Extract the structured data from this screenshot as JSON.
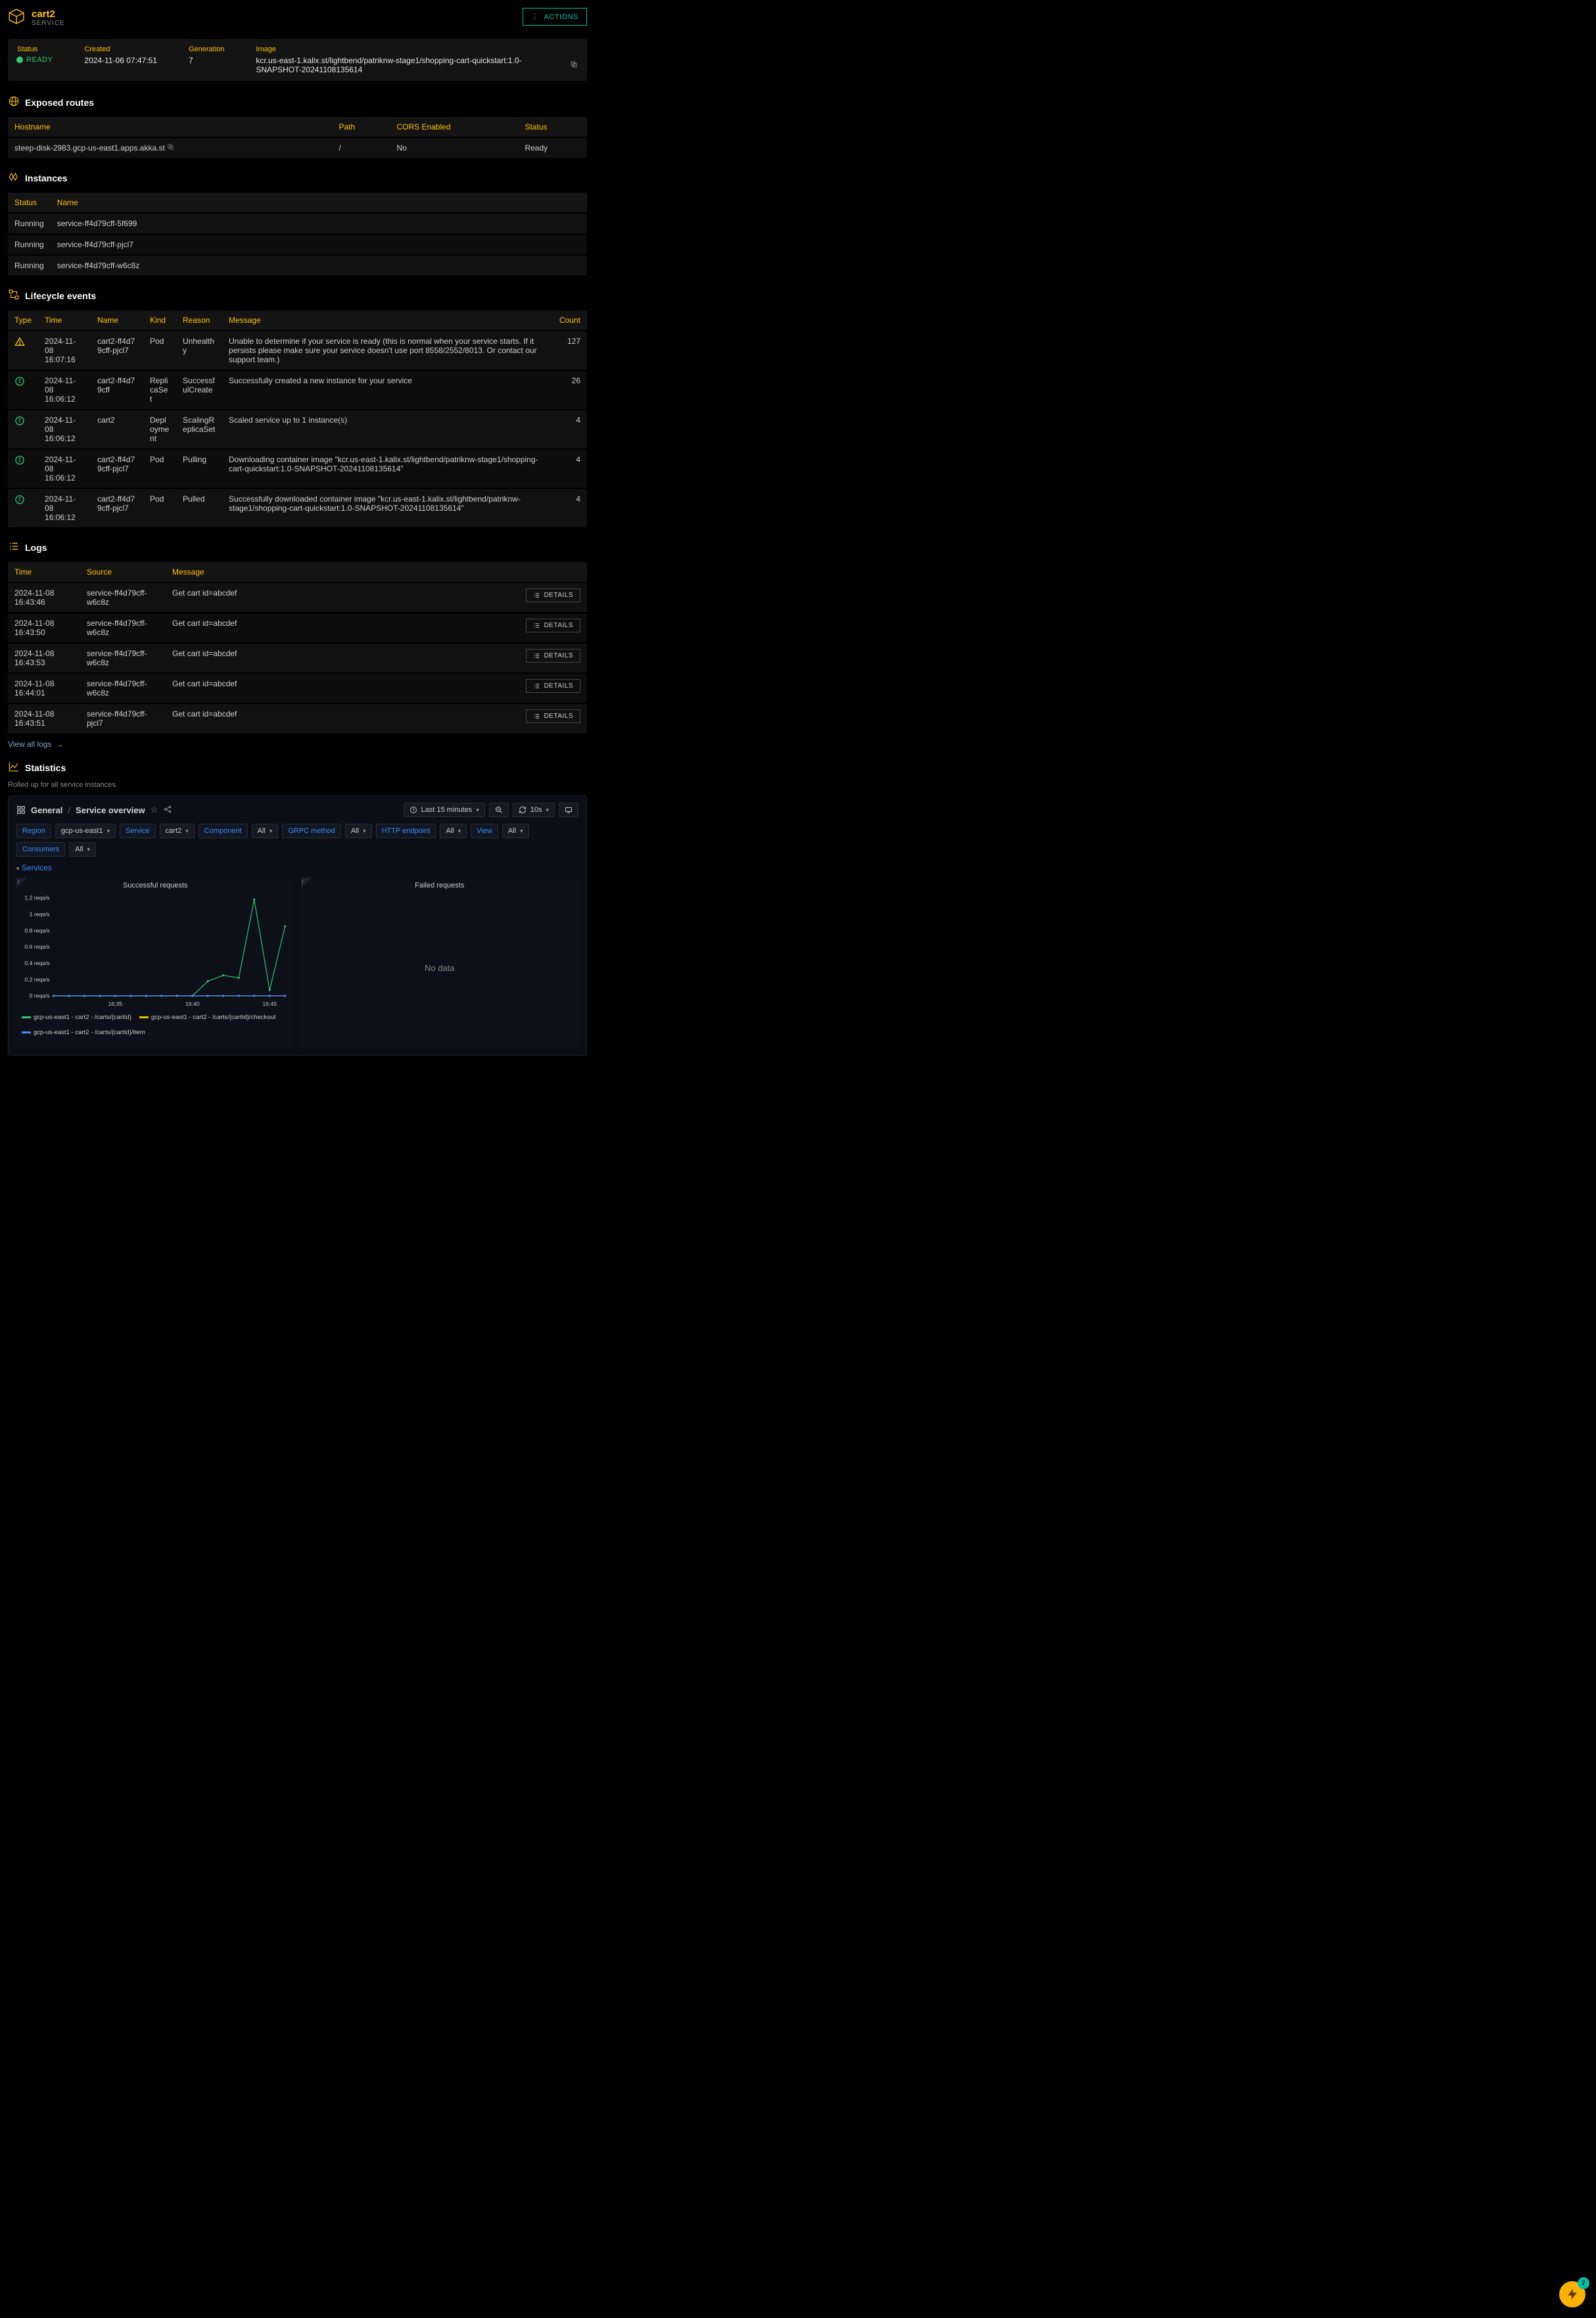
{
  "header": {
    "title": "cart2",
    "subtitle": "SERVICE",
    "actions_label": "ACTIONS"
  },
  "status_bar": {
    "status_label": "Status",
    "status_value": "READY",
    "created_label": "Created",
    "created_value": "2024-11-06 07:47:51",
    "generation_label": "Generation",
    "generation_value": "7",
    "image_label": "Image",
    "image_value": "kcr.us-east-1.kalix.st/lightbend/patriknw-stage1/shopping-cart-quickstart:1.0-SNAPSHOT-20241108135614"
  },
  "routes": {
    "heading": "Exposed routes",
    "cols": {
      "host": "Hostname",
      "path": "Path",
      "cors": "CORS Enabled",
      "status": "Status"
    },
    "rows": [
      {
        "host": "steep-disk-2983.gcp-us-east1.apps.akka.st",
        "path": "/",
        "cors": "No",
        "status": "Ready"
      }
    ]
  },
  "instances": {
    "heading": "Instances",
    "cols": {
      "status": "Status",
      "name": "Name"
    },
    "rows": [
      {
        "status": "Running",
        "name": "service-ff4d79cff-5f699"
      },
      {
        "status": "Running",
        "name": "service-ff4d79cff-pjcl7"
      },
      {
        "status": "Running",
        "name": "service-ff4d79cff-w6c8z"
      }
    ]
  },
  "lifecycle": {
    "heading": "Lifecycle events",
    "cols": {
      "type": "Type",
      "time": "Time",
      "name": "Name",
      "kind": "Kind",
      "reason": "Reason",
      "message": "Message",
      "count": "Count"
    },
    "rows": [
      {
        "icon": "warn",
        "time": "2024-11-08 16:07:16",
        "name": "cart2-ff4d79cff-pjcl7",
        "kind": "Pod",
        "reason": "Unhealthy",
        "message": "Unable to determine if your service is ready (this is normal when your service starts. If it persists please make sure your service doesn't use port 8558/2552/8013. Or contact our support team.)",
        "count": "127"
      },
      {
        "icon": "info",
        "time": "2024-11-08 16:06:12",
        "name": "cart2-ff4d79cff",
        "kind": "ReplicaSet",
        "reason": "SuccessfulCreate",
        "message": "Successfully created a new instance for your service",
        "count": "26"
      },
      {
        "icon": "info",
        "time": "2024-11-08 16:06:12",
        "name": "cart2",
        "kind": "Deployment",
        "reason": "ScalingReplicaSet",
        "message": "Scaled service up to 1 instance(s)",
        "count": "4"
      },
      {
        "icon": "info",
        "time": "2024-11-08 16:06:12",
        "name": "cart2-ff4d79cff-pjcl7",
        "kind": "Pod",
        "reason": "Pulling",
        "message": "Downloading container image \"kcr.us-east-1.kalix.st/lightbend/patriknw-stage1/shopping-cart-quickstart:1.0-SNAPSHOT-20241108135614\"",
        "count": "4"
      },
      {
        "icon": "info",
        "time": "2024-11-08 16:06:12",
        "name": "cart2-ff4d79cff-pjcl7",
        "kind": "Pod",
        "reason": "Pulled",
        "message": "Successfully downloaded container image \"kcr.us-east-1.kalix.st/lightbend/patriknw-stage1/shopping-cart-quickstart:1.0-SNAPSHOT-20241108135614\"",
        "count": "4"
      }
    ]
  },
  "logs": {
    "heading": "Logs",
    "cols": {
      "time": "Time",
      "source": "Source",
      "message": "Message"
    },
    "details_label": "DETAILS",
    "view_all": "View all logs",
    "rows": [
      {
        "time": "2024-11-08 16:43:46",
        "source": "service-ff4d79cff-w6c8z",
        "message": "Get cart id=abcdef"
      },
      {
        "time": "2024-11-08 16:43:50",
        "source": "service-ff4d79cff-w6c8z",
        "message": "Get cart id=abcdef"
      },
      {
        "time": "2024-11-08 16:43:53",
        "source": "service-ff4d79cff-w6c8z",
        "message": "Get cart id=abcdef"
      },
      {
        "time": "2024-11-08 16:44:01",
        "source": "service-ff4d79cff-w6c8z",
        "message": "Get cart id=abcdef"
      },
      {
        "time": "2024-11-08 16:43:51",
        "source": "service-ff4d79cff-pjcl7",
        "message": "Get cart id=abcdef"
      }
    ]
  },
  "stats": {
    "heading": "Statistics",
    "note": "Rolled up for all service instances.",
    "breadcrumb_root": "General",
    "breadcrumb_page": "Service overview",
    "time_label": "Last 15 minutes",
    "refresh_interval": "10s",
    "filters": {
      "region_label": "Region",
      "region_value": "gcp-us-east1",
      "service_label": "Service",
      "service_value": "cart2",
      "component_label": "Component",
      "component_value": "All",
      "grpc_label": "GRPC method",
      "grpc_value": "All",
      "http_label": "HTTP endpoint",
      "http_value": "All",
      "view_label": "View",
      "view_value": "All",
      "consumers_label": "Consumers",
      "consumers_value": "All"
    },
    "services_label": "Services",
    "chart1_title": "Successful requests",
    "chart2_title": "Failed requests",
    "no_data": "No data",
    "legend": [
      {
        "color": "#2ecc71",
        "label": "gcp-us-east1 - cart2 - /carts/{cartId}"
      },
      {
        "color": "#e6c200",
        "label": "gcp-us-east1 - cart2 - /carts/{cartId}/checkout"
      },
      {
        "color": "#3d8bfd",
        "label": "gcp-us-east1 - cart2 - /carts/{cartId}/item"
      }
    ],
    "yticks": [
      "1.2 reqs/s",
      "1 reqs/s",
      "0.8 reqs/s",
      "0.6 reqs/s",
      "0.4 reqs/s",
      "0.2 reqs/s",
      "0 reqs/s"
    ],
    "xticks": [
      "16:35",
      "16:40",
      "16:45"
    ]
  },
  "fab": {
    "badge": "7"
  },
  "chart_data": {
    "type": "line",
    "title": "Successful requests",
    "xlabel": "",
    "ylabel": "reqs/s",
    "ylim": [
      0,
      1.2
    ],
    "x_range_minutes": [
      "16:31",
      "16:46"
    ],
    "categories_minutes": [
      0,
      1,
      2,
      3,
      4,
      5,
      6,
      7,
      8,
      9,
      10,
      11,
      12,
      13,
      14,
      15
    ],
    "series": [
      {
        "name": "gcp-us-east1 - cart2 - /carts/{cartId}",
        "color": "#2ecc71",
        "values": [
          0,
          0,
          0,
          0,
          0,
          0,
          0,
          0,
          0,
          0,
          0.18,
          0.25,
          0.22,
          1.18,
          0.07,
          0.85
        ]
      },
      {
        "name": "gcp-us-east1 - cart2 - /carts/{cartId}/checkout",
        "color": "#e6c200",
        "values": [
          0,
          0,
          0,
          0,
          0,
          0,
          0,
          0,
          0,
          0,
          0,
          0,
          0,
          0,
          0,
          0
        ]
      },
      {
        "name": "gcp-us-east1 - cart2 - /carts/{cartId}/item",
        "color": "#3d8bfd",
        "values": [
          0,
          0,
          0,
          0,
          0,
          0,
          0,
          0,
          0,
          0,
          0,
          0,
          0,
          0,
          0,
          0
        ]
      }
    ]
  }
}
